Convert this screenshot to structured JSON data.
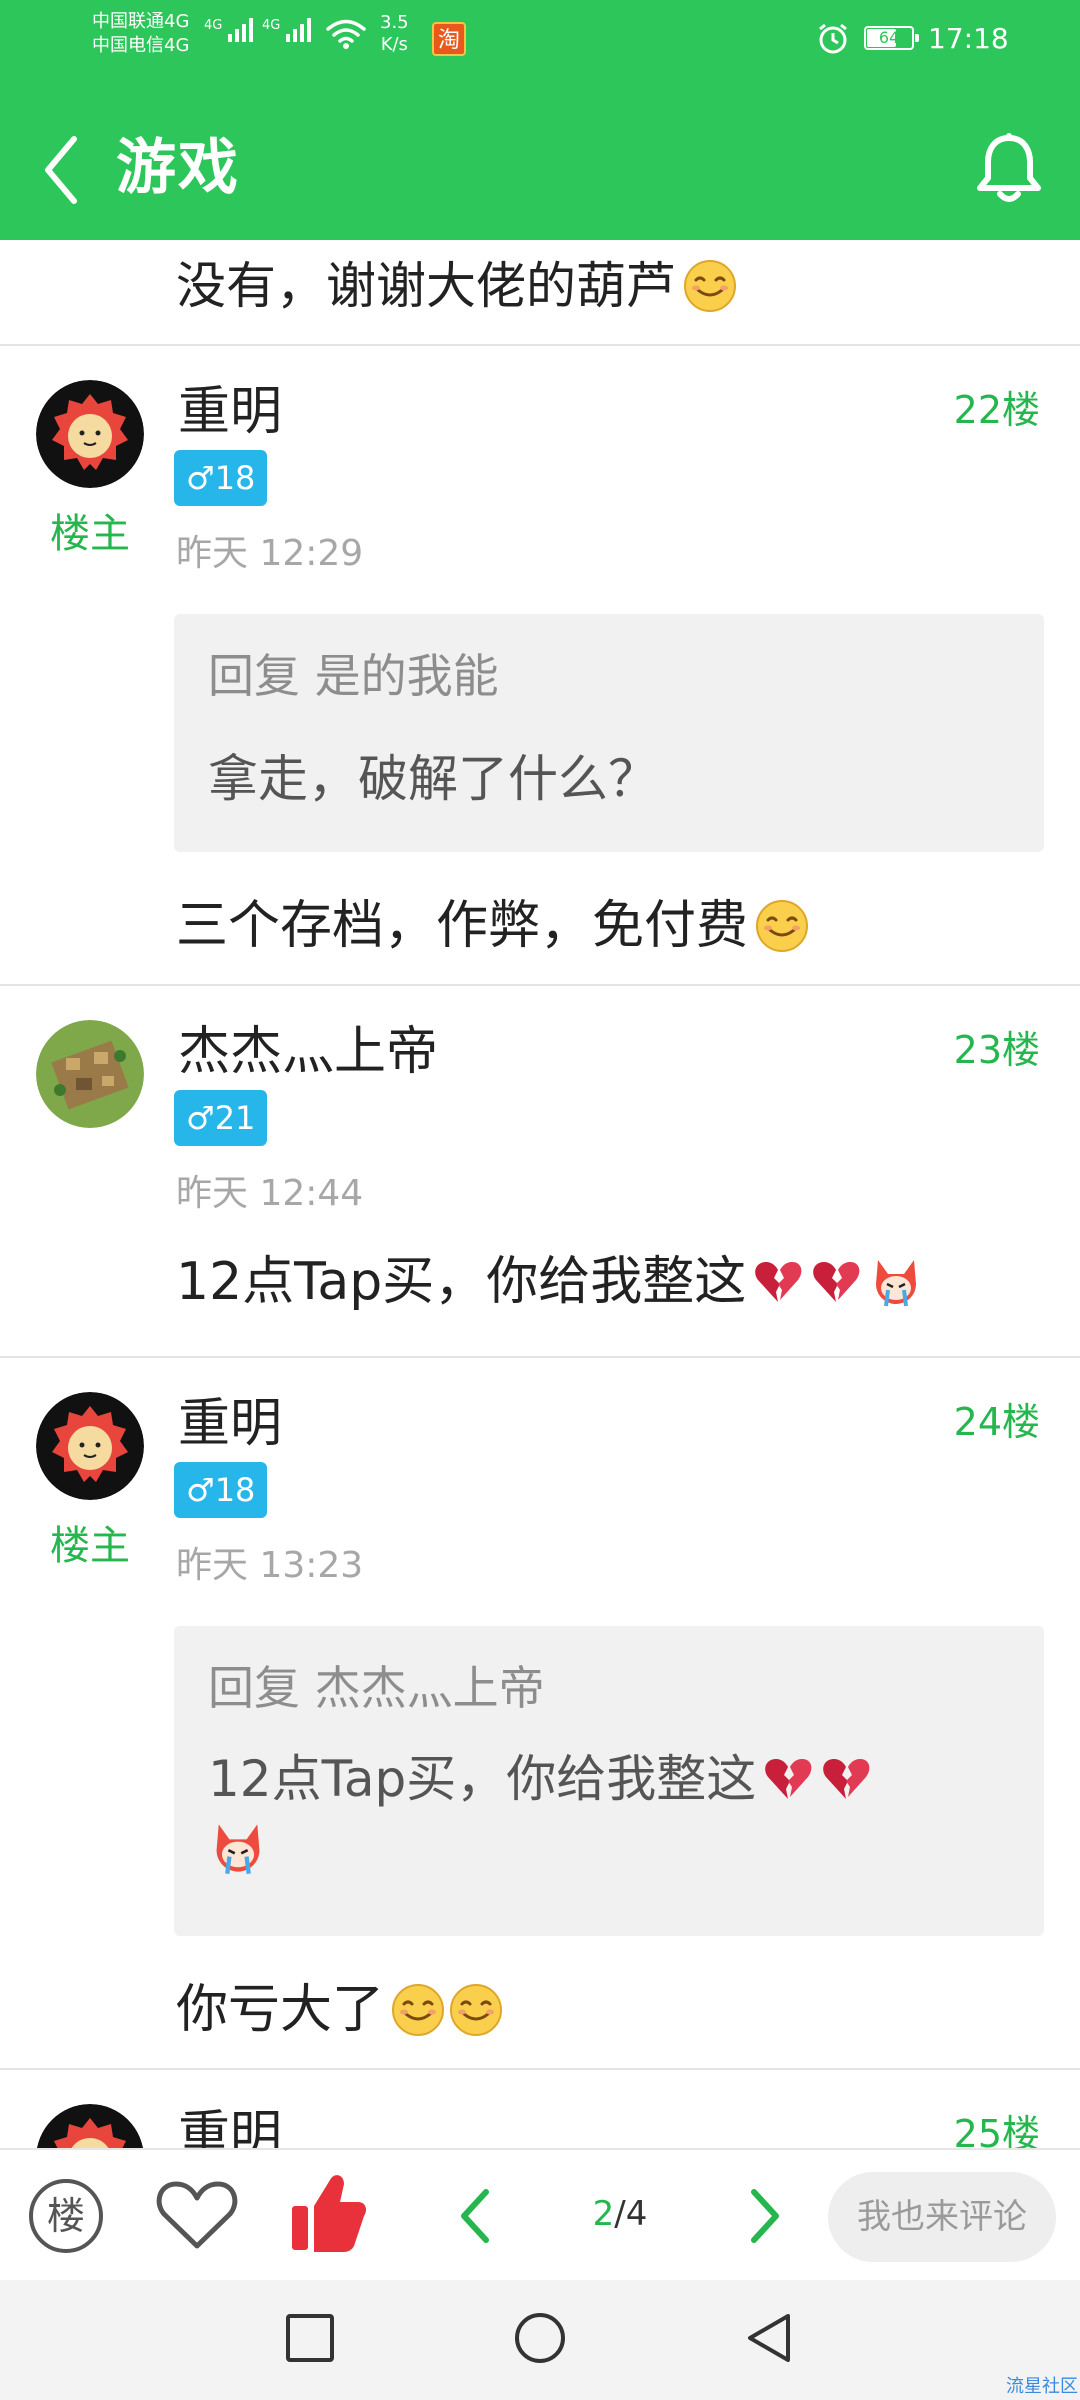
{
  "status": {
    "carrier1": "中国联通4G",
    "carrier2": "中国电信4G",
    "net1": "4G",
    "net2": "4G",
    "speed_value": "3.5",
    "speed_unit": "K/s",
    "tao_icon": "淘",
    "battery": "64",
    "time": "17:18"
  },
  "header": {
    "title": "游戏"
  },
  "prev_tail": {
    "text": "没有，谢谢大佬的葫芦"
  },
  "posts": [
    {
      "username": "重明",
      "is_op_label": "楼主",
      "floor": "22楼",
      "badge": "♂18",
      "time": "昨天 12:29",
      "quote_head": "回复 是的我能",
      "quote_body": "拿走，破解了什么？",
      "body": "三个存档，作弊，免付费"
    },
    {
      "username": "杰杰灬上帝",
      "floor": "23楼",
      "badge": "♂21",
      "time": "昨天 12:44",
      "body": "12点Tap买，你给我整这"
    },
    {
      "username": "重明",
      "is_op_label": "楼主",
      "floor": "24楼",
      "badge": "♂18",
      "time": "昨天 13:23",
      "quote_head": "回复 杰杰灬上帝",
      "quote_body": "12点Tap买，你给我整这",
      "body": "你亏大了"
    },
    {
      "username": "重明",
      "floor": "25楼"
    }
  ],
  "toolbar": {
    "floor_icon_label": "楼",
    "page_current": "2",
    "page_sep_total": "/4",
    "comment_placeholder": "我也来评论"
  },
  "watermark": "流星社区",
  "colors": {
    "brand_green": "#2cc65a",
    "badge_blue": "#26b6ea",
    "like_red": "#e8313a"
  }
}
